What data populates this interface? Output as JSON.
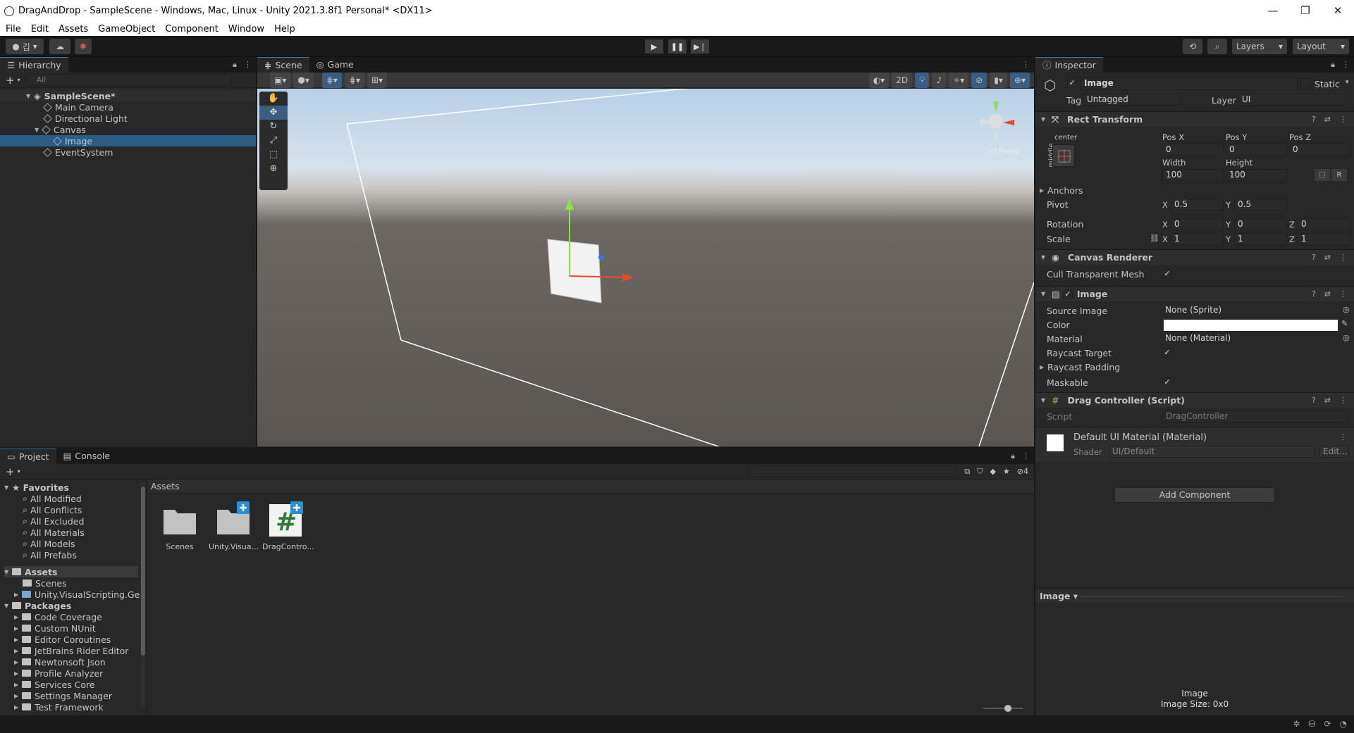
{
  "window": {
    "title": "DragAndDrop - SampleScene - Windows, Mac, Linux - Unity 2021.3.8f1 Personal* <DX11>",
    "controls": [
      "—",
      "❐",
      "✕"
    ]
  },
  "menu": [
    "File",
    "Edit",
    "Assets",
    "GameObject",
    "Component",
    "Window",
    "Help"
  ],
  "toolbar": {
    "account": "김",
    "layers": "Layers",
    "layout": "Layout"
  },
  "hierarchy": {
    "tab": "Hierarchy",
    "search_placeholder": "All",
    "scene": "SampleScene*",
    "items": [
      "Main Camera",
      "Directional Light",
      "Canvas",
      "Image",
      "EventSystem"
    ]
  },
  "scene": {
    "tabs": [
      "Scene",
      "Game"
    ],
    "mode_2d": "2D",
    "persp": "Persp"
  },
  "inspector": {
    "tab": "Inspector",
    "object_name": "Image",
    "static": "Static",
    "tag_label": "Tag",
    "tag": "Untagged",
    "layer_label": "Layer",
    "layer": "UI",
    "rect": {
      "title": "Rect Transform",
      "anchor_h": "center",
      "anchor_v": "middle",
      "posx_label": "Pos X",
      "posy_label": "Pos Y",
      "posz_label": "Pos Z",
      "posx": "0",
      "posy": "0",
      "posz": "0",
      "width_label": "Width",
      "height_label": "Height",
      "width": "100",
      "height": "100",
      "r_btn": "R",
      "anchors": "Anchors",
      "pivot": "Pivot",
      "pivot_x": "0.5",
      "pivot_y": "0.5",
      "rotation": "Rotation",
      "rot_x": "0",
      "rot_y": "0",
      "rot_z": "0",
      "scale": "Scale",
      "scale_x": "1",
      "scale_y": "1",
      "scale_z": "1",
      "x": "X",
      "y": "Y",
      "z": "Z"
    },
    "canvas_renderer": {
      "title": "Canvas Renderer",
      "cull": "Cull Transparent Mesh"
    },
    "image": {
      "title": "Image",
      "source_label": "Source Image",
      "source": "None (Sprite)",
      "color_label": "Color",
      "material_label": "Material",
      "material": "None (Material)",
      "raycast_target": "Raycast Target",
      "raycast_padding": "Raycast Padding",
      "maskable": "Maskable"
    },
    "script": {
      "title": "Drag Controller (Script)",
      "label": "Script",
      "value": "DragController"
    },
    "material": {
      "title": "Default UI Material (Material)",
      "shader_label": "Shader",
      "shader": "UI/Default",
      "edit": "Edit..."
    },
    "add_component": "Add Component",
    "preview": {
      "dropdown": "Image",
      "name": "Image",
      "size": "Image Size: 0x0"
    }
  },
  "project": {
    "tabs": [
      "Project",
      "Console"
    ],
    "favorites_title": "Favorites",
    "favorites": [
      "All Modified",
      "All Conflicts",
      "All Excluded",
      "All Materials",
      "All Models",
      "All Prefabs"
    ],
    "assets_title": "Assets",
    "assets_children": [
      "Scenes",
      "Unity.VisualScripting.Gen"
    ],
    "packages_title": "Packages",
    "packages": [
      "Code Coverage",
      "Custom NUnit",
      "Editor Coroutines",
      "JetBrains Rider Editor",
      "Newtonsoft Json",
      "Profile Analyzer",
      "Services Core",
      "Settings Manager",
      "Test Framework"
    ],
    "breadcrumb": "Assets",
    "count": "4",
    "grid": [
      "Scenes",
      "Unity.Visua...",
      "DragContro..."
    ]
  },
  "colors": {
    "accent": "#2c5d87",
    "panel": "#282828",
    "dark": "#191919"
  }
}
